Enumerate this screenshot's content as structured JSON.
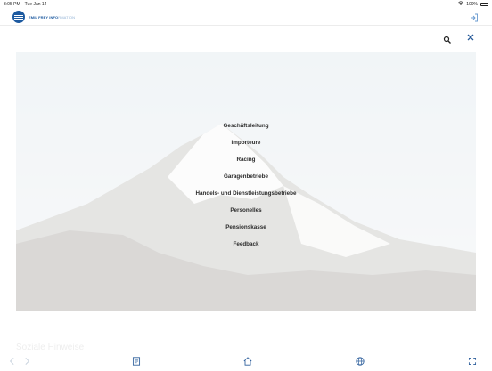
{
  "status_bar": {
    "time": "3:05 PM",
    "date": "Tue Jan 14",
    "battery": "100%"
  },
  "header": {
    "logo_text_bold": "EMIL FREY INFO",
    "logo_text_light": "RMATION"
  },
  "menu": {
    "items": [
      "Geschäftsleitung",
      "Importeure",
      "Racing",
      "Garagenbetriebe",
      "Handels- und Dienstleistungsbetriebe",
      "Personelles",
      "Pensionskasse",
      "Feedback"
    ]
  },
  "background_text": "Soziale Hinweise",
  "icons": {
    "logout": "logout-icon",
    "search": "search-icon",
    "close": "close-icon",
    "back": "chevron-left-icon",
    "forward": "chevron-right-icon",
    "news": "newspaper-icon",
    "home": "home-icon",
    "web": "globe-icon",
    "expand": "expand-icon"
  },
  "colors": {
    "brand": "#1d5aa0",
    "accent": "#2a5c9a",
    "text": "#2b2b2b"
  }
}
